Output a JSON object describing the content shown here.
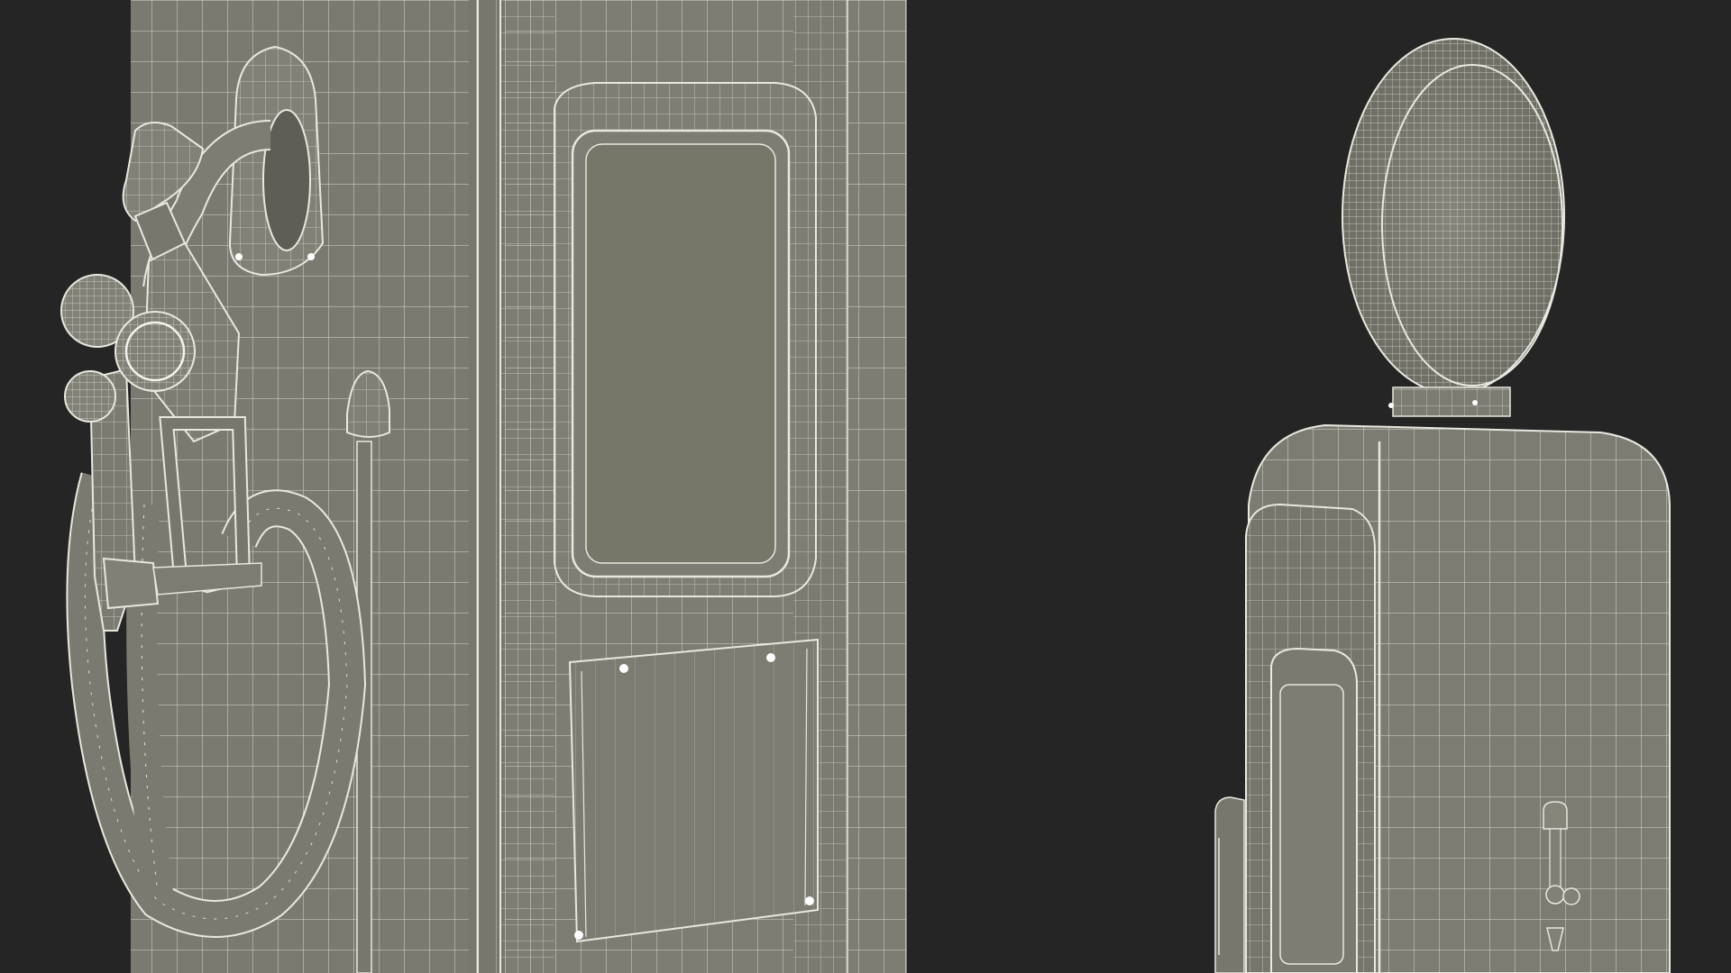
{
  "scene": {
    "background_color": "#252525",
    "mesh_fill_color": "#7b7b71",
    "mesh_shadow_color": "#6b6b62",
    "wire_color": "#e8e8e0",
    "views": [
      {
        "name": "closeup-view",
        "subject": "gas-pump-with-nozzle-and-hose"
      },
      {
        "name": "full-view",
        "subject": "vintage-gas-pump-with-globe-top"
      }
    ]
  }
}
